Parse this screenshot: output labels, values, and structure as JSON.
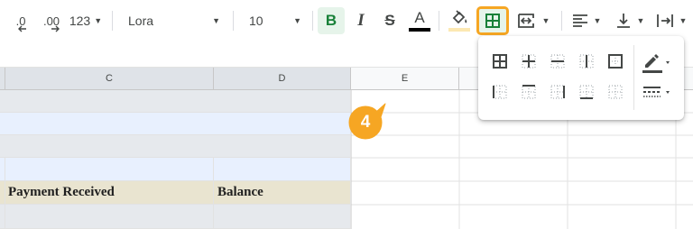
{
  "toolbar": {
    "decrease_decimal": ".0",
    "increase_decimal": ".00",
    "number_format": "123",
    "font_name": "Lora",
    "font_size": "10",
    "bold": "B",
    "italic": "I",
    "strikethrough": "S",
    "text_color": "A"
  },
  "columns": [
    "C",
    "D",
    "E"
  ],
  "rows": {
    "payment_received": "Payment Received",
    "balance": "Balance"
  },
  "step_badge": "4",
  "colors": {
    "accent": "#f6a623",
    "selected_button_bg": "#e6f4ea",
    "green_icon": "#188038",
    "header_fill": "#e9e4d0",
    "light_blue_row": "#e8f0fe",
    "gray_row": "#e6e9ed"
  }
}
